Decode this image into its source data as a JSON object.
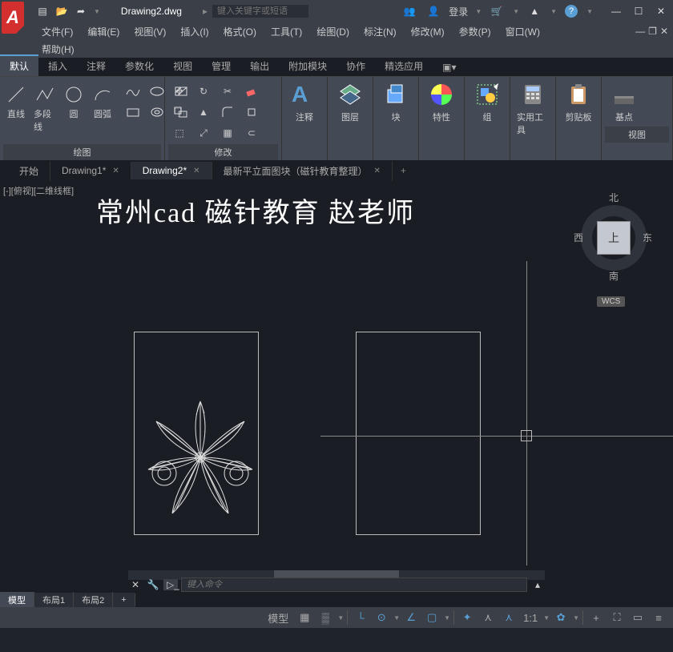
{
  "titlebar": {
    "doc_name": "Drawing2.dwg",
    "search_placeholder": "键入关键字或短语",
    "login_label": "登录"
  },
  "menubar": {
    "items": [
      "文件(F)",
      "编辑(E)",
      "视图(V)",
      "插入(I)",
      "格式(O)",
      "工具(T)",
      "绘图(D)",
      "标注(N)",
      "修改(M)",
      "参数(P)",
      "窗口(W)"
    ],
    "help": "帮助(H)"
  },
  "ribbon_tabs": [
    "默认",
    "插入",
    "注释",
    "参数化",
    "视图",
    "管理",
    "输出",
    "附加模块",
    "协作",
    "精选应用"
  ],
  "ribbon": {
    "draw": {
      "title": "绘图",
      "line": "直线",
      "polyline": "多段线",
      "circle": "圆",
      "arc": "圆弧"
    },
    "modify": {
      "title": "修改"
    },
    "annotate": "注释",
    "layers": "图层",
    "block": "块",
    "properties": "特性",
    "group": "组",
    "utilities": "实用工具",
    "clipboard": "剪贴板",
    "base": "基点",
    "view": "视图"
  },
  "doc_tabs": [
    {
      "label": "开始",
      "closable": false,
      "active": false
    },
    {
      "label": "Drawing1*",
      "closable": true,
      "active": false
    },
    {
      "label": "Drawing2*",
      "closable": true,
      "active": true
    },
    {
      "label": "最新平立面图块（磁针教育整理）",
      "closable": true,
      "active": false
    }
  ],
  "canvas": {
    "view_label": "[-][俯视][二维线框]",
    "watermark": "常州cad 磁针教育 赵老师",
    "viewcube": {
      "top": "上",
      "n": "北",
      "s": "南",
      "e": "东",
      "w": "西",
      "wcs": "WCS"
    },
    "cmd_placeholder": "键入命令"
  },
  "layout_tabs": [
    "模型",
    "布局1",
    "布局2"
  ],
  "statusbar": {
    "model": "模型",
    "scale": "1:1"
  }
}
